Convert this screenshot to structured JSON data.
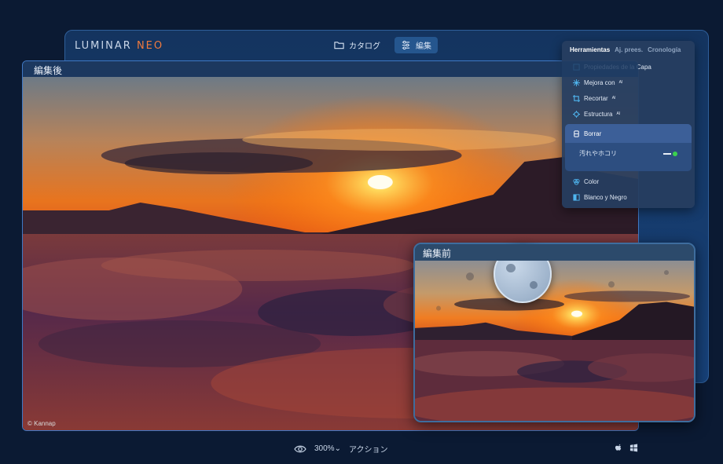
{
  "app": {
    "logo_main": "LUMINAR ",
    "logo_accent": "NEO"
  },
  "top_tabs": [
    {
      "label": "カタログ",
      "icon": "folder-icon",
      "active": false
    },
    {
      "label": "編集",
      "icon": "sliders-icon",
      "active": true
    }
  ],
  "after_panel": {
    "title": "編集後",
    "copyright": "© Kannap"
  },
  "before_panel": {
    "title": "編集前"
  },
  "tools": {
    "tabs": [
      {
        "label": "Herramientas",
        "active": true
      },
      {
        "label": "Aj. prees.",
        "active": false
      },
      {
        "label": "Cronología",
        "active": false
      }
    ],
    "items_top": [
      {
        "label": "Propiedades de la Capa",
        "ai": "",
        "icon": "layer-icon"
      },
      {
        "label": "Mejora con",
        "ai": "AI",
        "icon": "enhance-icon"
      },
      {
        "label": "Recortar",
        "ai": "AI",
        "icon": "crop-icon"
      },
      {
        "label": "Estructura",
        "ai": "AI",
        "icon": "structure-icon"
      }
    ],
    "borrar": {
      "label": "Borrar",
      "option_label": "汚れやホコリ",
      "option_enabled": true,
      "accent": "#3bd14e"
    },
    "items_bottom": [
      {
        "label": "Color",
        "icon": "color-icon"
      },
      {
        "label": "Blanco y Negro",
        "icon": "bw-icon"
      }
    ]
  },
  "bottom_bar": {
    "zoom": "300%",
    "action_label": "アクション"
  },
  "colors": {
    "background": "#0b1a33",
    "accent": "#f07a3e",
    "panel_border": "#3f78c4"
  }
}
